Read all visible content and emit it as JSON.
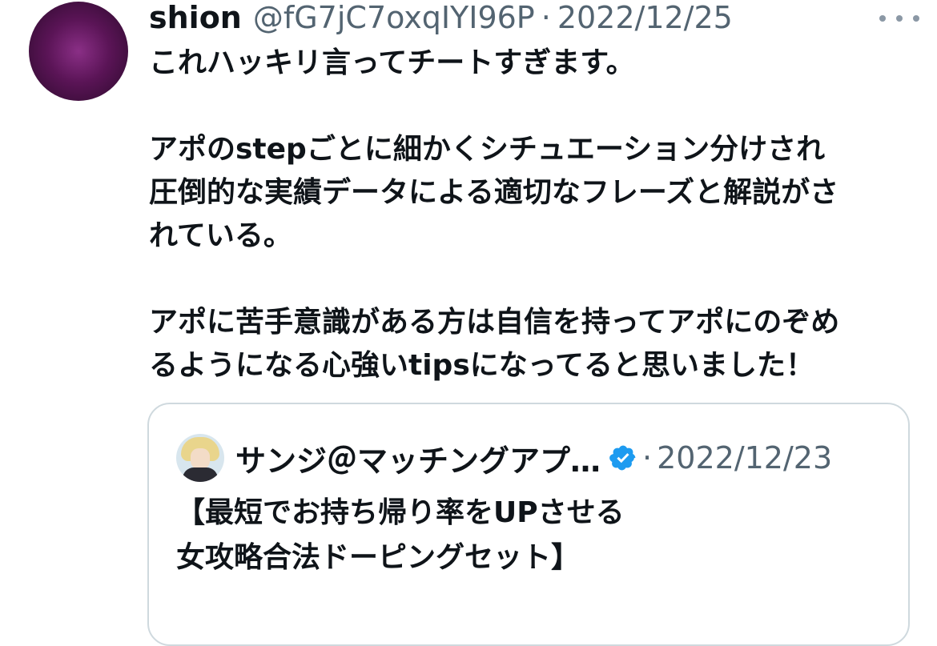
{
  "tweet": {
    "display_name": "shion",
    "handle": "@fG7jC7oxqIYI96P",
    "separator": "·",
    "date": "2022/12/25",
    "more_icon": "ellipsis-icon",
    "lines": [
      "これハッキリ言ってチートすぎます。",
      "",
      "アポのstepごとに細かくシチュエーション分けされ",
      "圧倒的な実績データによる適切なフレーズと解説がさ",
      "れている。",
      "",
      "アポに苦手意識がある方は自信を持ってアポにのぞめ",
      "るようになる心強いtipsになってると思いました！"
    ]
  },
  "quoted": {
    "display_name": "サンジ＠マッチングアプ…",
    "verified_icon": "verified-badge-icon",
    "separator": "·",
    "date": "2022/12/23",
    "lines": [
      "【最短でお持ち帰り率をUPさせる",
      "女攻略合法ドーピングセット】"
    ]
  },
  "colors": {
    "text": "#0f1419",
    "secondary": "#536471",
    "border": "#cfd9de",
    "verified": "#1d9bf0"
  }
}
